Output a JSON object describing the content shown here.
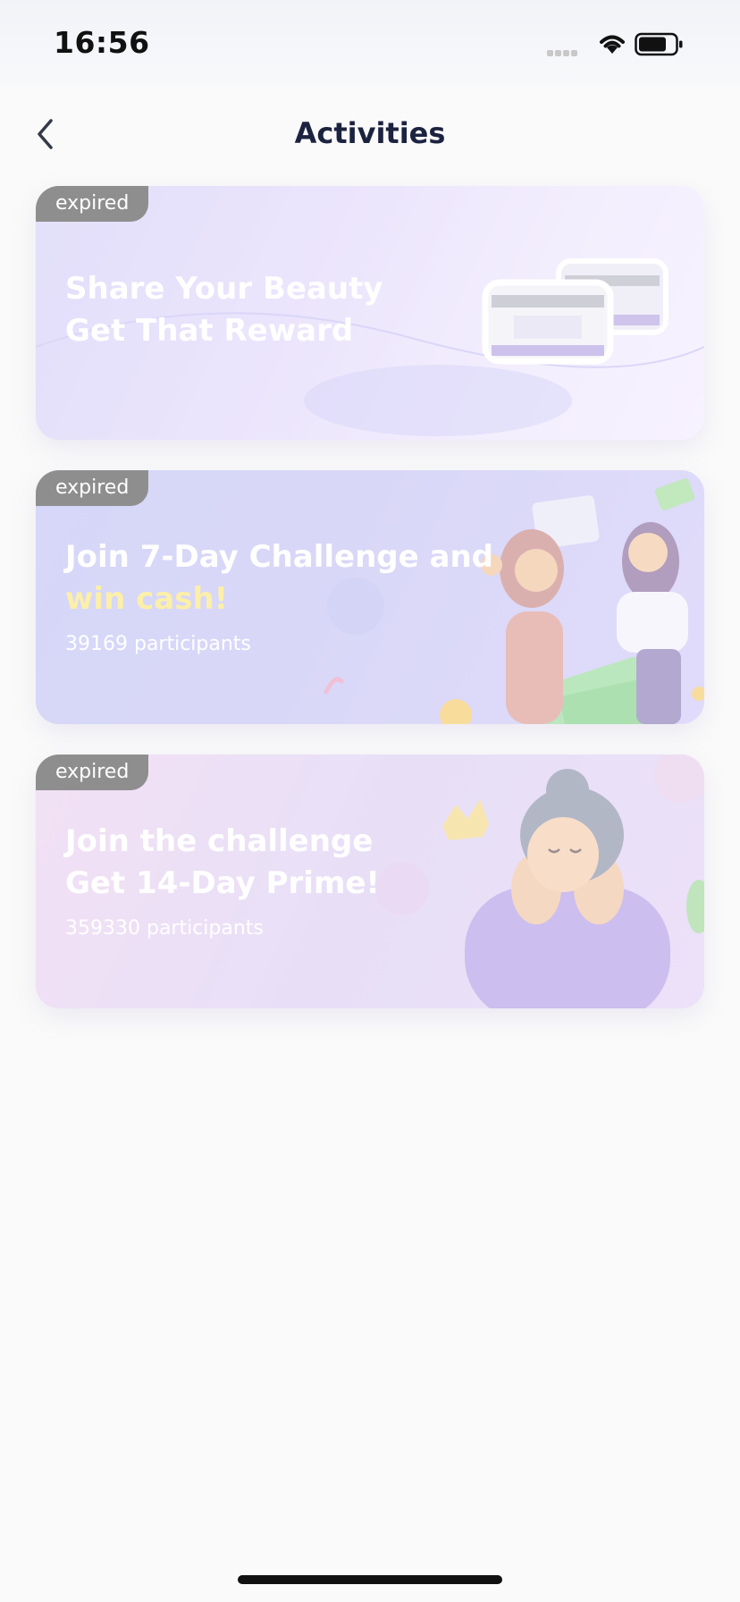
{
  "status_bar": {
    "time": "16:56"
  },
  "header": {
    "title": "Activities",
    "back_icon": "chevron-left-icon"
  },
  "cards": [
    {
      "badge": "expired",
      "title_line1": "Share Your Beauty",
      "title_line2": "Get That Reward",
      "participants": "",
      "art": "cream-jars"
    },
    {
      "badge": "expired",
      "title_line1": "Join 7-Day Challenge and",
      "title_line2": "win cash!",
      "participants": "39169 participants",
      "art": "women-with-cash"
    },
    {
      "badge": "expired",
      "title_line1": "Join the challenge",
      "title_line2": "Get 14-Day Prime!",
      "participants": "359330 participants",
      "art": "smiling-woman-crown"
    }
  ],
  "colors": {
    "accent_yellow": "#fcefa8",
    "badge_gray": "#8e8e8e",
    "title_navy": "#1c2340"
  }
}
